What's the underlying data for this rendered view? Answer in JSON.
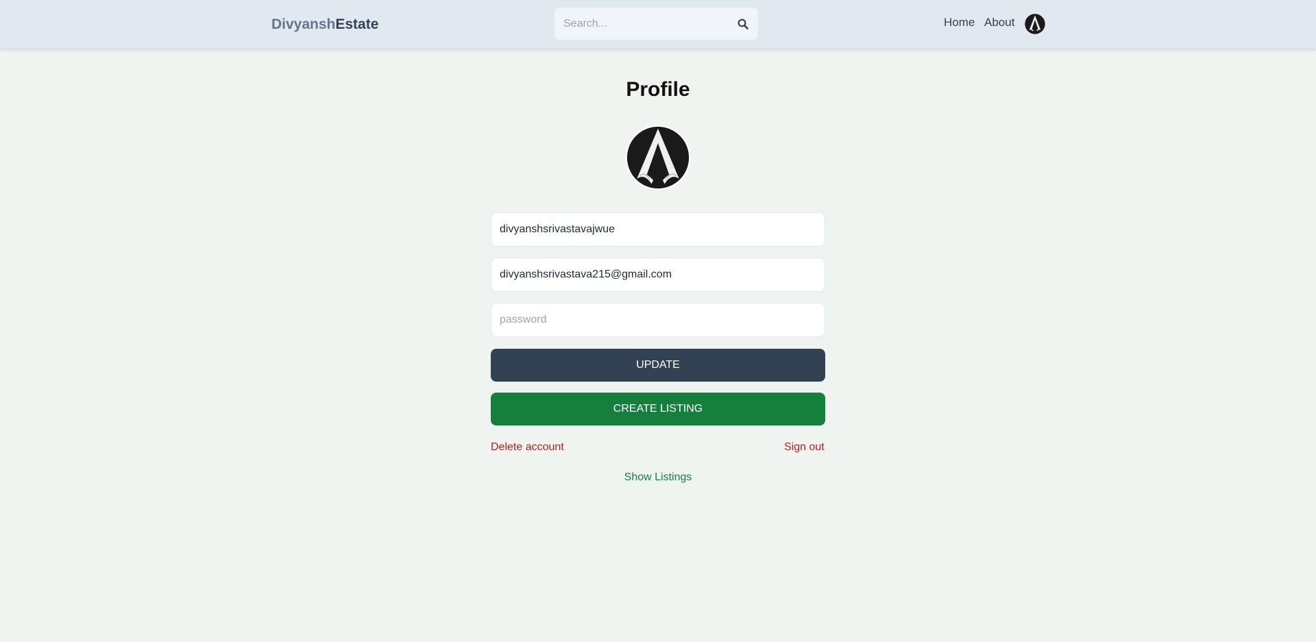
{
  "header": {
    "brand_part1": "Divyansh",
    "brand_part2": "Estate",
    "search_placeholder": "Search...",
    "search_icon": "search-icon",
    "nav": {
      "home": "Home",
      "about": "About"
    },
    "avatar_icon": "assassin-emblem-avatar"
  },
  "profile": {
    "title": "Profile",
    "avatar_icon": "assassin-emblem-avatar",
    "username_value": "divyanshsrivastavajwue",
    "email_value": "divyanshsrivastava215@gmail.com",
    "password_placeholder": "password",
    "update_label": "UPDATE",
    "create_listing_label": "CREATE LISTING",
    "delete_account_label": "Delete account",
    "sign_out_label": "Sign out",
    "show_listings_label": "Show Listings"
  },
  "colors": {
    "header_bg": "#e2e8f0",
    "page_bg": "#f0f4f1",
    "update_btn": "#334155",
    "create_btn": "#15803d",
    "danger_text": "#b91c1c",
    "success_text": "#15803d"
  }
}
